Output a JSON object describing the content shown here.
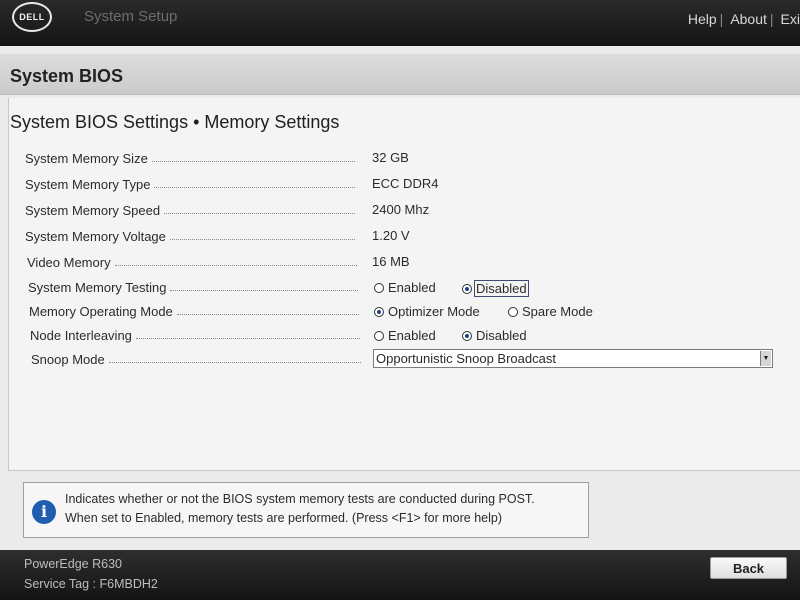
{
  "topbar": {
    "logo_text": "DELL",
    "app_title": "System Setup",
    "links": [
      "Help",
      "About",
      "Exi"
    ]
  },
  "page": {
    "title": "System BIOS",
    "breadcrumb": "System BIOS Settings • Memory Settings"
  },
  "settings": {
    "memory_size": {
      "label": "System Memory Size",
      "value": "32 GB"
    },
    "memory_type": {
      "label": "System Memory Type",
      "value": "ECC DDR4"
    },
    "memory_speed": {
      "label": "System Memory Speed",
      "value": "2400 Mhz"
    },
    "memory_voltage": {
      "label": "System Memory Voltage",
      "value": "1.20 V"
    },
    "video_memory": {
      "label": "Video Memory",
      "value": "16 MB"
    },
    "memory_testing": {
      "label": "System Memory Testing",
      "options": [
        "Enabled",
        "Disabled"
      ],
      "selected": "Disabled"
    },
    "operating_mode": {
      "label": "Memory Operating Mode",
      "options": [
        "Optimizer Mode",
        "Spare Mode"
      ],
      "selected": "Optimizer Mode"
    },
    "node_interleaving": {
      "label": "Node Interleaving",
      "options": [
        "Enabled",
        "Disabled"
      ],
      "selected": "Disabled"
    },
    "snoop_mode": {
      "label": "Snoop Mode",
      "value": "Opportunistic Snoop Broadcast"
    }
  },
  "help": {
    "line1": "Indicates whether or not the BIOS system memory tests are conducted during POST.",
    "line2": "When set to Enabled, memory tests are performed. (Press <F1> for more help)"
  },
  "footer": {
    "model": "PowerEdge R630",
    "service_tag": "Service Tag : F6MBDH2",
    "back_label": "Back"
  },
  "colors": {
    "header_bg": "#1b1b1b",
    "content_bg": "#f4f4f4",
    "info_icon": "#1f5db0",
    "radio_dot": "#1e3f8f"
  }
}
